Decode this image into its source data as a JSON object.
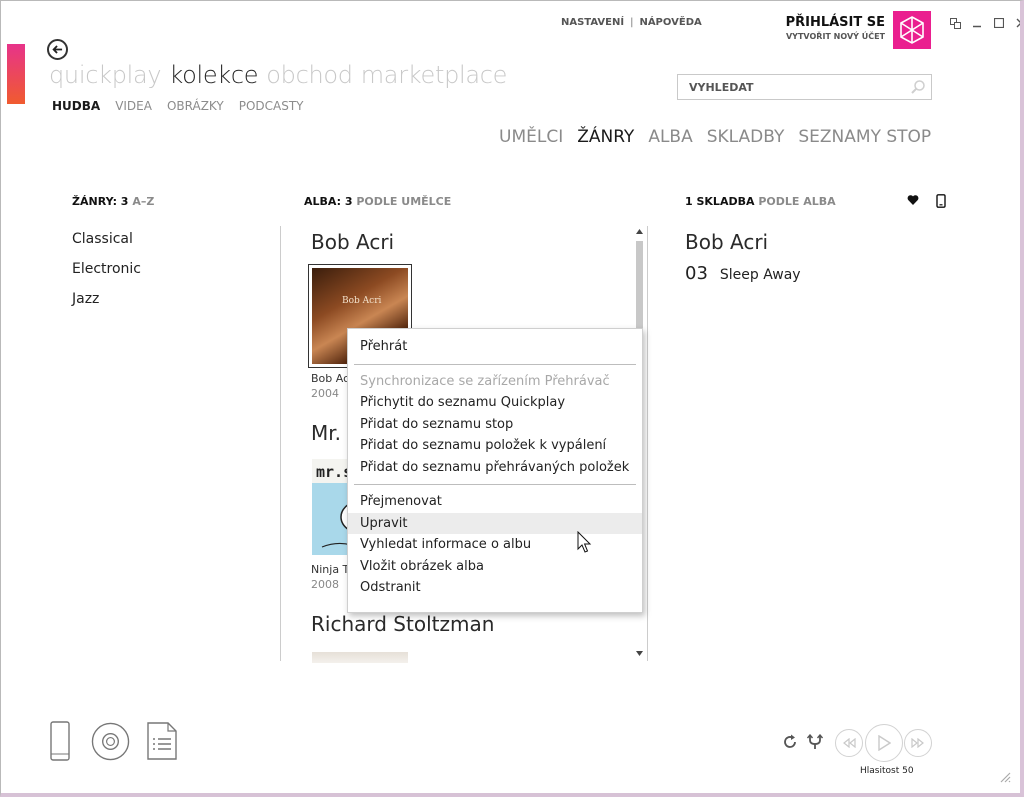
{
  "nav": {
    "pivots": [
      "quickplay",
      "kolekce",
      "obchod",
      "marketplace"
    ],
    "active_pivot": "kolekce",
    "subnav": [
      "HUDBA",
      "VIDEA",
      "OBRÁZKY",
      "PODCASTY"
    ],
    "active_subnav": "HUDBA"
  },
  "top_links": {
    "settings": "NASTAVENÍ",
    "separator": "|",
    "help": "NÁPOVĚDA"
  },
  "account": {
    "sign_in": "PŘIHLÁSIT SE",
    "create": "VYTVOŘIT NOVÝ ÚČET"
  },
  "search": {
    "placeholder": "VYHLEDAT"
  },
  "categories": [
    "UMĚLCI",
    "ŽÁNRY",
    "ALBA",
    "SKLADBY",
    "SEZNAMY STOP"
  ],
  "active_category": "ŽÁNRY",
  "columns": {
    "genres": {
      "count": "ŽÁNRY: 3",
      "sort": "A–Z"
    },
    "albums": {
      "count": "ALBA: 3",
      "sort": "PODLE UMĚLCE"
    },
    "songs": {
      "count": "1 SKLADBA",
      "sort": "PODLE ALBA"
    }
  },
  "genres": [
    "Classical",
    "Electronic",
    "Jazz"
  ],
  "albums": [
    {
      "artist": "Bob Acri",
      "title": "Bob Ac",
      "year": "2004",
      "art_text": "Bob Acri"
    },
    {
      "artist": "Mr.",
      "title": "Ninja T",
      "year": "2008",
      "art_text": "mr.s"
    },
    {
      "artist": "Richard Stoltzman"
    }
  ],
  "songs": {
    "artist": "Bob Acri",
    "items": [
      {
        "num": "03",
        "title": "Sleep Away"
      }
    ]
  },
  "context_menu": {
    "group1": [
      "Přehrát"
    ],
    "group2_disabled": "Synchronizace se zařízením Přehrávač",
    "group2": [
      "Přichytit do seznamu Quickplay",
      "Přidat do seznamu stop",
      "Přidat do seznamu položek k vypálení",
      "Přidat do seznamu přehrávaných položek"
    ],
    "group3": [
      "Přejmenovat",
      "Upravit",
      "Vyhledat informace o albu",
      "Vložit obrázek alba",
      "Odstranit"
    ],
    "hovered": "Upravit"
  },
  "player": {
    "volume_label": "Hlasitost 50"
  },
  "colors": {
    "accent": "#ea1f8f",
    "text": "#222222",
    "muted": "#8a8a8a"
  }
}
